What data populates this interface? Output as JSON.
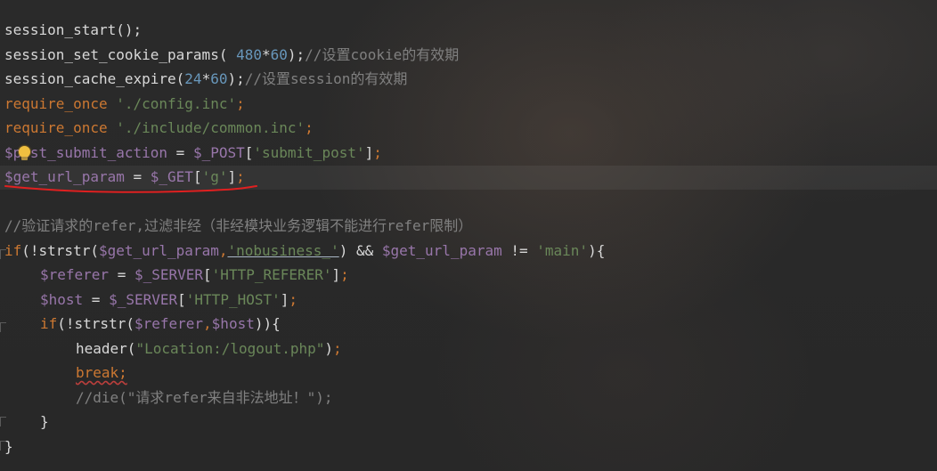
{
  "editor": {
    "lines": [
      {
        "id": "l1",
        "tokens": [
          [
            "fn",
            "session_start();"
          ]
        ]
      },
      {
        "id": "l2",
        "tokens": [
          [
            "fn",
            "session_set_cookie_params( "
          ],
          [
            "num",
            "480"
          ],
          [
            "plain",
            "*"
          ],
          [
            "num",
            "60"
          ],
          [
            "plain",
            ");"
          ],
          [
            "cmt",
            "//设置cookie的有效期"
          ]
        ]
      },
      {
        "id": "l3",
        "tokens": [
          [
            "fn",
            "session_cache_expire("
          ],
          [
            "num",
            "24"
          ],
          [
            "plain",
            "*"
          ],
          [
            "num",
            "60"
          ],
          [
            "plain",
            ");"
          ],
          [
            "cmt",
            "//设置session的有效期"
          ]
        ]
      },
      {
        "id": "l4",
        "tokens": [
          [
            "kw",
            "require_once "
          ],
          [
            "str",
            "'./config.inc'"
          ],
          [
            "kw",
            ";"
          ]
        ]
      },
      {
        "id": "l5",
        "tokens": [
          [
            "kw",
            "require_once "
          ],
          [
            "str",
            "'./include/common.inc'"
          ],
          [
            "kw",
            ";"
          ]
        ]
      },
      {
        "id": "l6",
        "tokens": [
          [
            "var",
            "$post_submit_action"
          ],
          [
            "plain",
            " = "
          ],
          [
            "var",
            "$_POST"
          ],
          [
            "plain",
            "["
          ],
          [
            "str",
            "'submit_post'"
          ],
          [
            "plain",
            "]"
          ],
          [
            "kw",
            ";"
          ]
        ]
      },
      {
        "id": "l7",
        "tokens": [
          [
            "var",
            "$get_url_param"
          ],
          [
            "plain",
            " = "
          ],
          [
            "var",
            "$_GET"
          ],
          [
            "plain",
            "["
          ],
          [
            "str",
            "'g'"
          ],
          [
            "plain",
            "]"
          ],
          [
            "kw",
            ";"
          ]
        ]
      },
      {
        "id": "l8",
        "tokens": []
      },
      {
        "id": "l9",
        "tokens": [
          [
            "cmt",
            "//验证请求的refer,过滤非经（非经模块业务逻辑不能进行refer限制）"
          ]
        ]
      },
      {
        "id": "l10",
        "tokens": [
          [
            "kw",
            "if"
          ],
          [
            "plain",
            "(!strstr("
          ],
          [
            "var",
            "$get_url_param"
          ],
          [
            "kw",
            ","
          ],
          [
            "str",
            "'nobusiness_'"
          ],
          [
            "plain",
            ") && "
          ],
          [
            "var",
            "$get_url_param"
          ],
          [
            "plain",
            " != "
          ],
          [
            "str",
            "'main'"
          ],
          [
            "plain",
            "){"
          ]
        ]
      },
      {
        "id": "l11",
        "indent": 1,
        "tokens": [
          [
            "var",
            "$referer"
          ],
          [
            "plain",
            " = "
          ],
          [
            "var",
            "$_SERVER"
          ],
          [
            "plain",
            "["
          ],
          [
            "str",
            "'HTTP_REFERER'"
          ],
          [
            "plain",
            "]"
          ],
          [
            "kw",
            ";"
          ]
        ]
      },
      {
        "id": "l12",
        "indent": 1,
        "tokens": [
          [
            "var",
            "$host"
          ],
          [
            "plain",
            " = "
          ],
          [
            "var",
            "$_SERVER"
          ],
          [
            "plain",
            "["
          ],
          [
            "str",
            "'HTTP_HOST'"
          ],
          [
            "plain",
            "]"
          ],
          [
            "kw",
            ";"
          ]
        ]
      },
      {
        "id": "l13",
        "indent": 1,
        "tokens": [
          [
            "kw",
            "if"
          ],
          [
            "plain",
            "(!strstr("
          ],
          [
            "var",
            "$referer"
          ],
          [
            "kw",
            ","
          ],
          [
            "var",
            "$host"
          ],
          [
            "plain",
            ")){"
          ]
        ]
      },
      {
        "id": "l14",
        "indent": 2,
        "tokens": [
          [
            "fn",
            "header("
          ],
          [
            "str",
            "\"Location:/logout.php\""
          ],
          [
            "plain",
            ")"
          ],
          [
            "kw",
            ";"
          ]
        ]
      },
      {
        "id": "l15",
        "indent": 2,
        "tokens": [
          [
            "kw",
            "break;"
          ]
        ]
      },
      {
        "id": "l16",
        "indent": 2,
        "tokens": [
          [
            "cmt",
            "//die(\"请求refer来自非法地址！\");"
          ]
        ]
      },
      {
        "id": "l17",
        "indent": 1,
        "tokens": [
          [
            "plain",
            "}"
          ]
        ]
      },
      {
        "id": "l18",
        "tokens": [
          [
            "plain",
            "}"
          ]
        ]
      }
    ],
    "colors": {
      "background": "#2b2b2b",
      "keyword": "#cc7832",
      "string": "#6a8759",
      "number": "#6897bb",
      "variable": "#9876aa",
      "comment": "#808080",
      "default": "#d8d8d8",
      "annotation_red": "#e02020",
      "bulb": "#f0c040"
    },
    "icons": [
      "lightbulb-icon"
    ]
  }
}
